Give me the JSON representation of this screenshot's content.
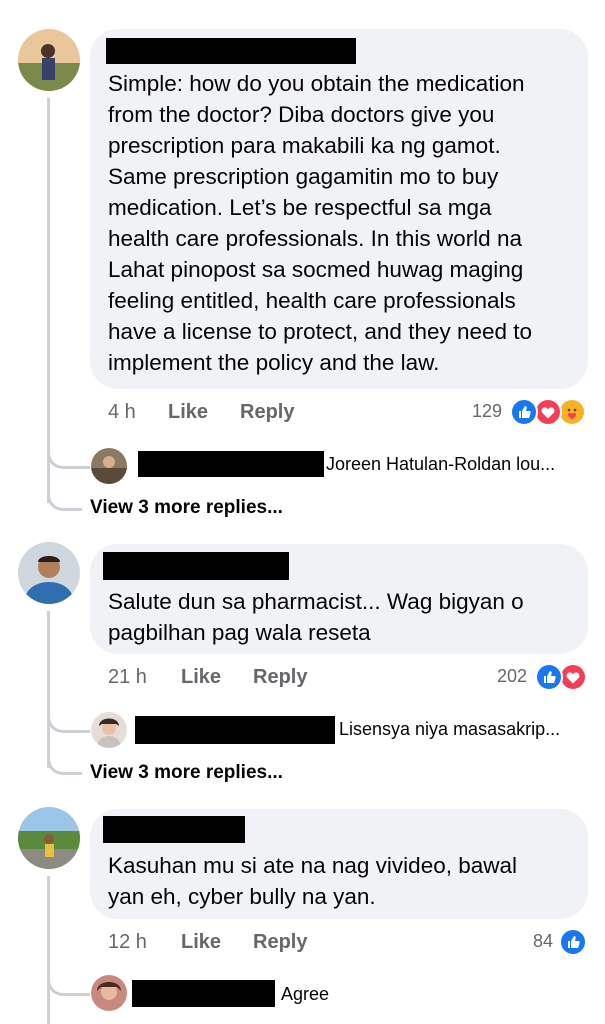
{
  "comments": [
    {
      "text": "Simple: how do you obtain the medication\nfrom the doctor? Diba doctors give you\nprescription para makabili ka ng gamot.\nSame prescription gagamitin mo to buy\nmedication. Let’s be respectful sa mga\nhealth care professionals. In this world na\nLahat pinopost sa socmed huwag maging\nfeeling entitled, health care professionals\nhave a license to protect, and they need to\nimplement the policy and the law.",
      "time": "4 h",
      "like_label": "Like",
      "reply_label": "Reply",
      "reaction_count": "129",
      "reactions": [
        "like-icon",
        "love-icon",
        "care-icon"
      ],
      "reply_preview": "Joreen Hatulan-Roldan lou...",
      "view_more": "View 3 more replies..."
    },
    {
      "text": "Salute dun sa pharmacist... Wag bigyan o\npagbilhan pag wala reseta",
      "time": "21 h",
      "like_label": "Like",
      "reply_label": "Reply",
      "reaction_count": "202",
      "reactions": [
        "like-icon",
        "love-icon"
      ],
      "reply_preview": "Lisensya niya masasakrip...",
      "view_more": "View 3 more replies..."
    },
    {
      "text": "Kasuhan mu si ate na nag vivideo, bawal\nyan eh, cyber bully na yan.",
      "time": "12 h",
      "like_label": "Like",
      "reply_label": "Reply",
      "reaction_count": "84",
      "reactions": [
        "like-icon"
      ],
      "reply_preview": "Agree"
    }
  ],
  "colors": {
    "like_blue": "#1877f2",
    "love_red": "#f33e58",
    "care_yellow": "#f7b125",
    "bubble": "#f0f2f5",
    "meta": "#65676b"
  }
}
